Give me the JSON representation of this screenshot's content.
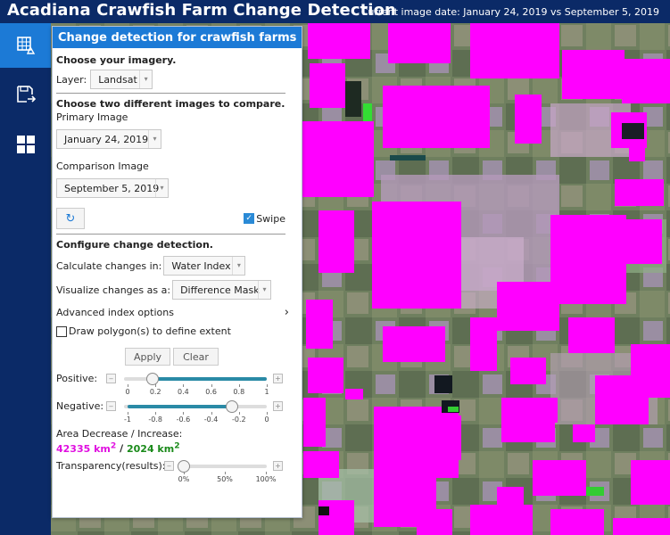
{
  "header": {
    "title": "Acadiana Crawfish Farm Change Detection",
    "date_label": "Current image date: January 24, 2019 vs September 5, 2019"
  },
  "rail": {
    "items": [
      {
        "icon": "change-detection-icon",
        "active": true
      },
      {
        "icon": "save-export-icon",
        "active": false
      },
      {
        "icon": "grid-apps-icon",
        "active": false
      }
    ]
  },
  "panel": {
    "title": "Change detection for crawfish farms",
    "imagery": {
      "heading": "Choose your imagery.",
      "layer_label": "Layer:",
      "layer_value": "Landsat"
    },
    "compare": {
      "heading": "Choose two different images to compare.",
      "primary_label": "Primary Image",
      "primary_value": "January 24, 2019",
      "comparison_label": "Comparison Image",
      "comparison_value": "September 5, 2019",
      "swipe_label": "Swipe",
      "swipe_checked": true
    },
    "config": {
      "heading": "Configure change detection.",
      "calc_label": "Calculate changes in:",
      "calc_value": "Water Index",
      "viz_label": "Visualize changes as a:",
      "viz_value": "Difference Mask",
      "advanced_label": "Advanced index options",
      "draw_label": "Draw polygon(s) to define extent",
      "apply_label": "Apply",
      "clear_label": "Clear"
    },
    "positive": {
      "label": "Positive:",
      "value": 0.18,
      "ticks": [
        "0",
        "0.2",
        "0.4",
        "0.6",
        "0.8",
        "1"
      ]
    },
    "negative": {
      "label": "Negative:",
      "value": -0.25,
      "ticks": [
        "-1",
        "-0.8",
        "-0.6",
        "-0.4",
        "-0.2",
        "0"
      ]
    },
    "area": {
      "label": "Area Decrease / Increase:",
      "decrease": "42335 km",
      "separator": "/",
      "increase": "2024 km",
      "sup": "2",
      "decrease_color": "#e010e0",
      "increase_color": "#1a8a1a"
    },
    "transparency": {
      "label": "Transparency(results):",
      "value": 0,
      "ticks": [
        "0%",
        "50%",
        "100%"
      ]
    }
  },
  "colors": {
    "header_bg": "#0b2a67",
    "accent": "#1c7ad6",
    "mask": "#ff00ff"
  }
}
